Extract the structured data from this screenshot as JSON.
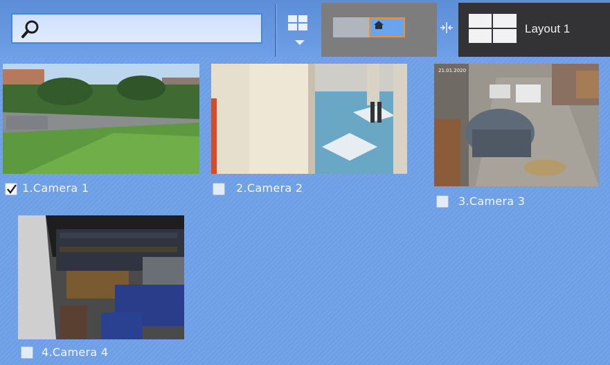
{
  "search": {
    "value": "",
    "placeholder": ""
  },
  "layout": {
    "title": "Layout 1"
  },
  "cameras": [
    {
      "label": "1.Camera 1",
      "checked": true
    },
    {
      "label": "2.Camera 2",
      "checked": false
    },
    {
      "label": "3.Camera 3",
      "checked": false
    },
    {
      "label": "4.Camera 4",
      "checked": false
    }
  ],
  "colors": {
    "background": "#6e9fe6",
    "accent_border": "#3e86e8",
    "active_slot_border": "#f3902a",
    "layout_tab": "#333336"
  },
  "icons": [
    "search-icon",
    "grid-layout-icon",
    "home-icon",
    "split-arrows-icon",
    "layout-grid-icon",
    "checkmark-icon"
  ]
}
